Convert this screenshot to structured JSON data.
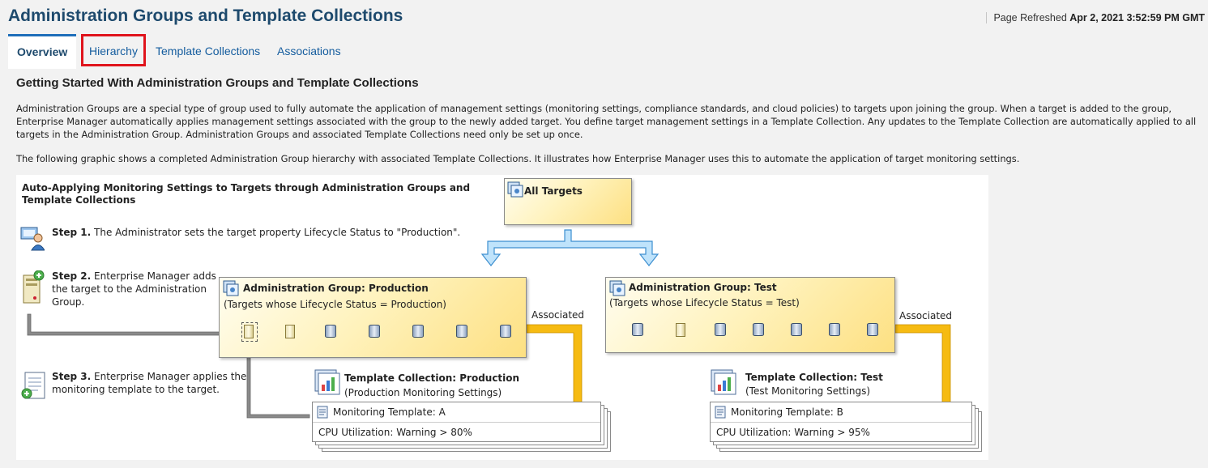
{
  "header": {
    "title": "Administration Groups and Template Collections",
    "refresh_label": "Page Refreshed",
    "refresh_time": "Apr 2, 2021 3:52:59 PM GMT"
  },
  "tabs": [
    {
      "label": "Overview",
      "active": true
    },
    {
      "label": "Hierarchy",
      "highlighted": true
    },
    {
      "label": "Template Collections"
    },
    {
      "label": "Associations"
    }
  ],
  "content": {
    "heading": "Getting Started With Administration Groups and Template Collections",
    "para1": "Administration Groups are a special type of group used to fully automate the application of management settings (monitoring settings, compliance standards, and cloud policies) to targets upon joining the group. When a target is added to the group, Enterprise Manager automatically applies management settings associated with the group to the newly added target. You define target management settings in a Template Collection. Any updates to the Template Collection are automatically applied to all targets in the Administration Group. Administration Groups and associated Template Collections need only be set up once.",
    "para2": "The following graphic shows a completed Administration Group hierarchy with associated Template Collections. It illustrates how Enterprise Manager uses this to automate the application of target monitoring settings."
  },
  "diagram": {
    "title_line1": "Auto-Applying Monitoring Settings to Targets through Administration Groups and",
    "title_line2": "Template Collections",
    "step1_label": "Step 1.",
    "step1_text": "The Administrator sets the target property Lifecycle Status to \"Production\".",
    "step2_label": "Step 2.",
    "step2_line1": "Enterprise Manager adds",
    "step2_line2": "the target to the Administration",
    "step2_line3": "Group.",
    "step3_label": "Step 3.",
    "step3_line1": "Enterprise Manager applies the",
    "step3_line2": "monitoring template to the target.",
    "all_targets": "All Targets",
    "group_prod_title": "Administration Group: Production",
    "group_prod_sub": "(Targets whose Lifecycle Status = Production)",
    "group_test_title": "Administration Group: Test",
    "group_test_sub": "(Targets whose Lifecycle Status = Test)",
    "associated": "Associated",
    "tc_prod_title": "Template Collection: Production",
    "tc_prod_sub": "(Production Monitoring Settings)",
    "tc_test_title": "Template Collection: Test",
    "tc_test_sub": "(Test Monitoring Settings)",
    "mt_a": "Monitoring Template: A",
    "mt_a_rule": "CPU Utilization: Warning > 80%",
    "mt_b": "Monitoring Template: B",
    "mt_b_rule": "CPU Utilization: Warning > 95%"
  },
  "colors": {
    "title": "#1e4a6d",
    "link": "#145c9e",
    "tab_active_bar": "#1f6fba",
    "highlight_box": "#e0141c",
    "arrow_blue": "#4aa3df",
    "associated_bar": "#f5b800"
  }
}
